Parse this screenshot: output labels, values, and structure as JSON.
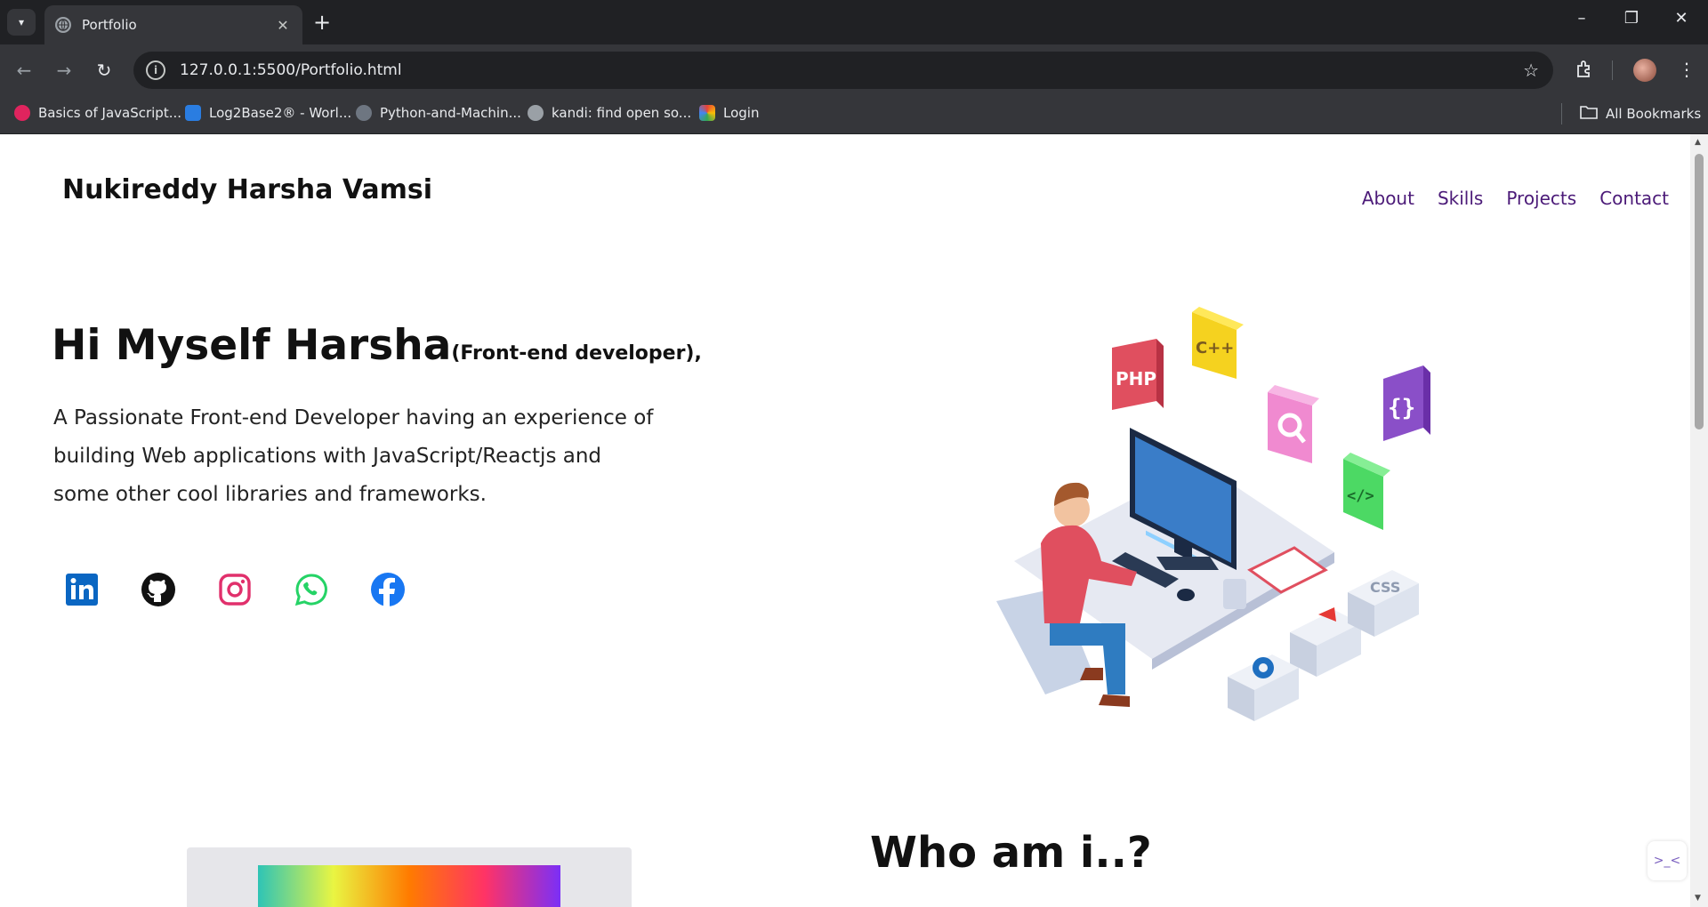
{
  "browser": {
    "tab_title": "Portfolio",
    "url": "127.0.0.1:5500/Portfolio.html",
    "bookmarks": [
      {
        "label": "Basics of JavaScript...",
        "color": "#e0245e"
      },
      {
        "label": "Log2Base2® - Worl...",
        "color": "#2a7de1"
      },
      {
        "label": "Python-and-Machin...",
        "color": "#6e7681"
      },
      {
        "label": "kandi: find open so...",
        "color": "#9aa0a6"
      },
      {
        "label": "Login",
        "color": "#f4b400"
      }
    ],
    "all_bookmarks": "All Bookmarks"
  },
  "site": {
    "brand": "Nukireddy Harsha Vamsi",
    "nav": [
      "About",
      "Skills",
      "Projects",
      "Contact"
    ],
    "hero": {
      "title": "Hi Myself Harsha",
      "subtitle": "(Front-end developer),",
      "description": "A Passionate Front-end Developer having an experience of building Web applications with JavaScript/Reactjs and some other cool libraries and frameworks."
    },
    "socials": [
      {
        "name": "linkedin-icon",
        "color": "#0a66c2"
      },
      {
        "name": "github-icon",
        "color": "#111111"
      },
      {
        "name": "instagram-icon",
        "color": "#e1306c"
      },
      {
        "name": "whatsapp-icon",
        "color": "#25d366"
      },
      {
        "name": "facebook-icon",
        "color": "#1877f2"
      }
    ],
    "illustration_labels": {
      "php": "PHP",
      "cpp": "C++",
      "braces": "{}",
      "code": "</>",
      "css": "CSS"
    },
    "who_heading": "Who am i..?"
  }
}
